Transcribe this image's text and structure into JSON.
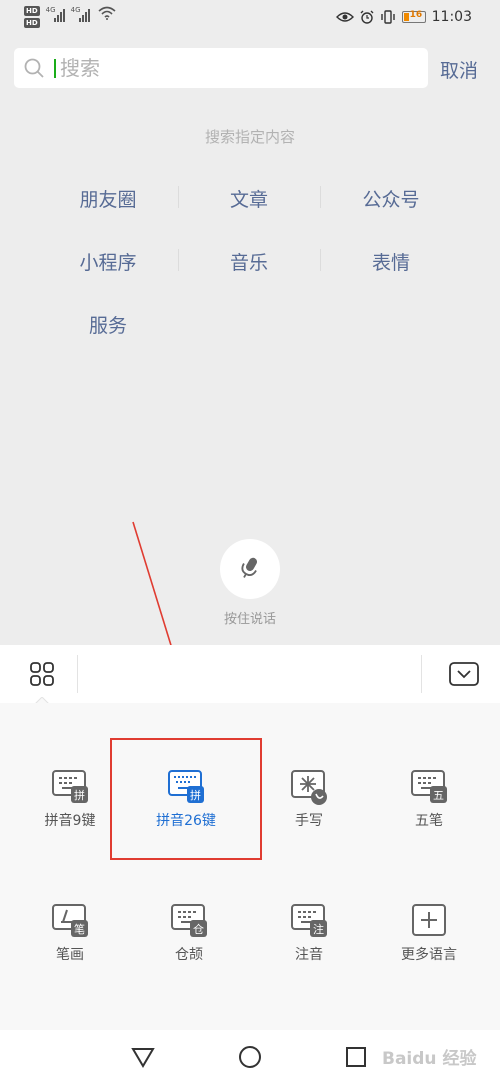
{
  "status": {
    "hd1": "HD",
    "hd2": "HD",
    "sig1": "4G",
    "sig2": "4G",
    "battery": "16",
    "time": "11:03"
  },
  "search": {
    "placeholder": "搜索",
    "cancel_label": "取消"
  },
  "hint_title": "搜索指定内容",
  "categories": [
    [
      "朋友圈",
      "文章",
      "公众号"
    ],
    [
      "小程序",
      "音乐",
      "表情"
    ],
    [
      "服务"
    ]
  ],
  "voice": {
    "label": "按住说话"
  },
  "keyboard": {
    "items": [
      {
        "label": "拼音9键",
        "badge": "拼"
      },
      {
        "label": "拼音26键",
        "badge": "拼",
        "selected": true
      },
      {
        "label": "手写",
        "badge": ""
      },
      {
        "label": "五笔",
        "badge": "五"
      },
      {
        "label": "笔画",
        "badge": "笔"
      },
      {
        "label": "仓颉",
        "badge": "仓"
      },
      {
        "label": "注音",
        "badge": "注"
      },
      {
        "label": "更多语言",
        "badge": "+"
      }
    ]
  },
  "watermark": "Baidu 经验",
  "colors": {
    "link": "#576b95",
    "accent": "#1f6fd3",
    "annotation": "#e03c31",
    "caret": "#1aad19"
  }
}
